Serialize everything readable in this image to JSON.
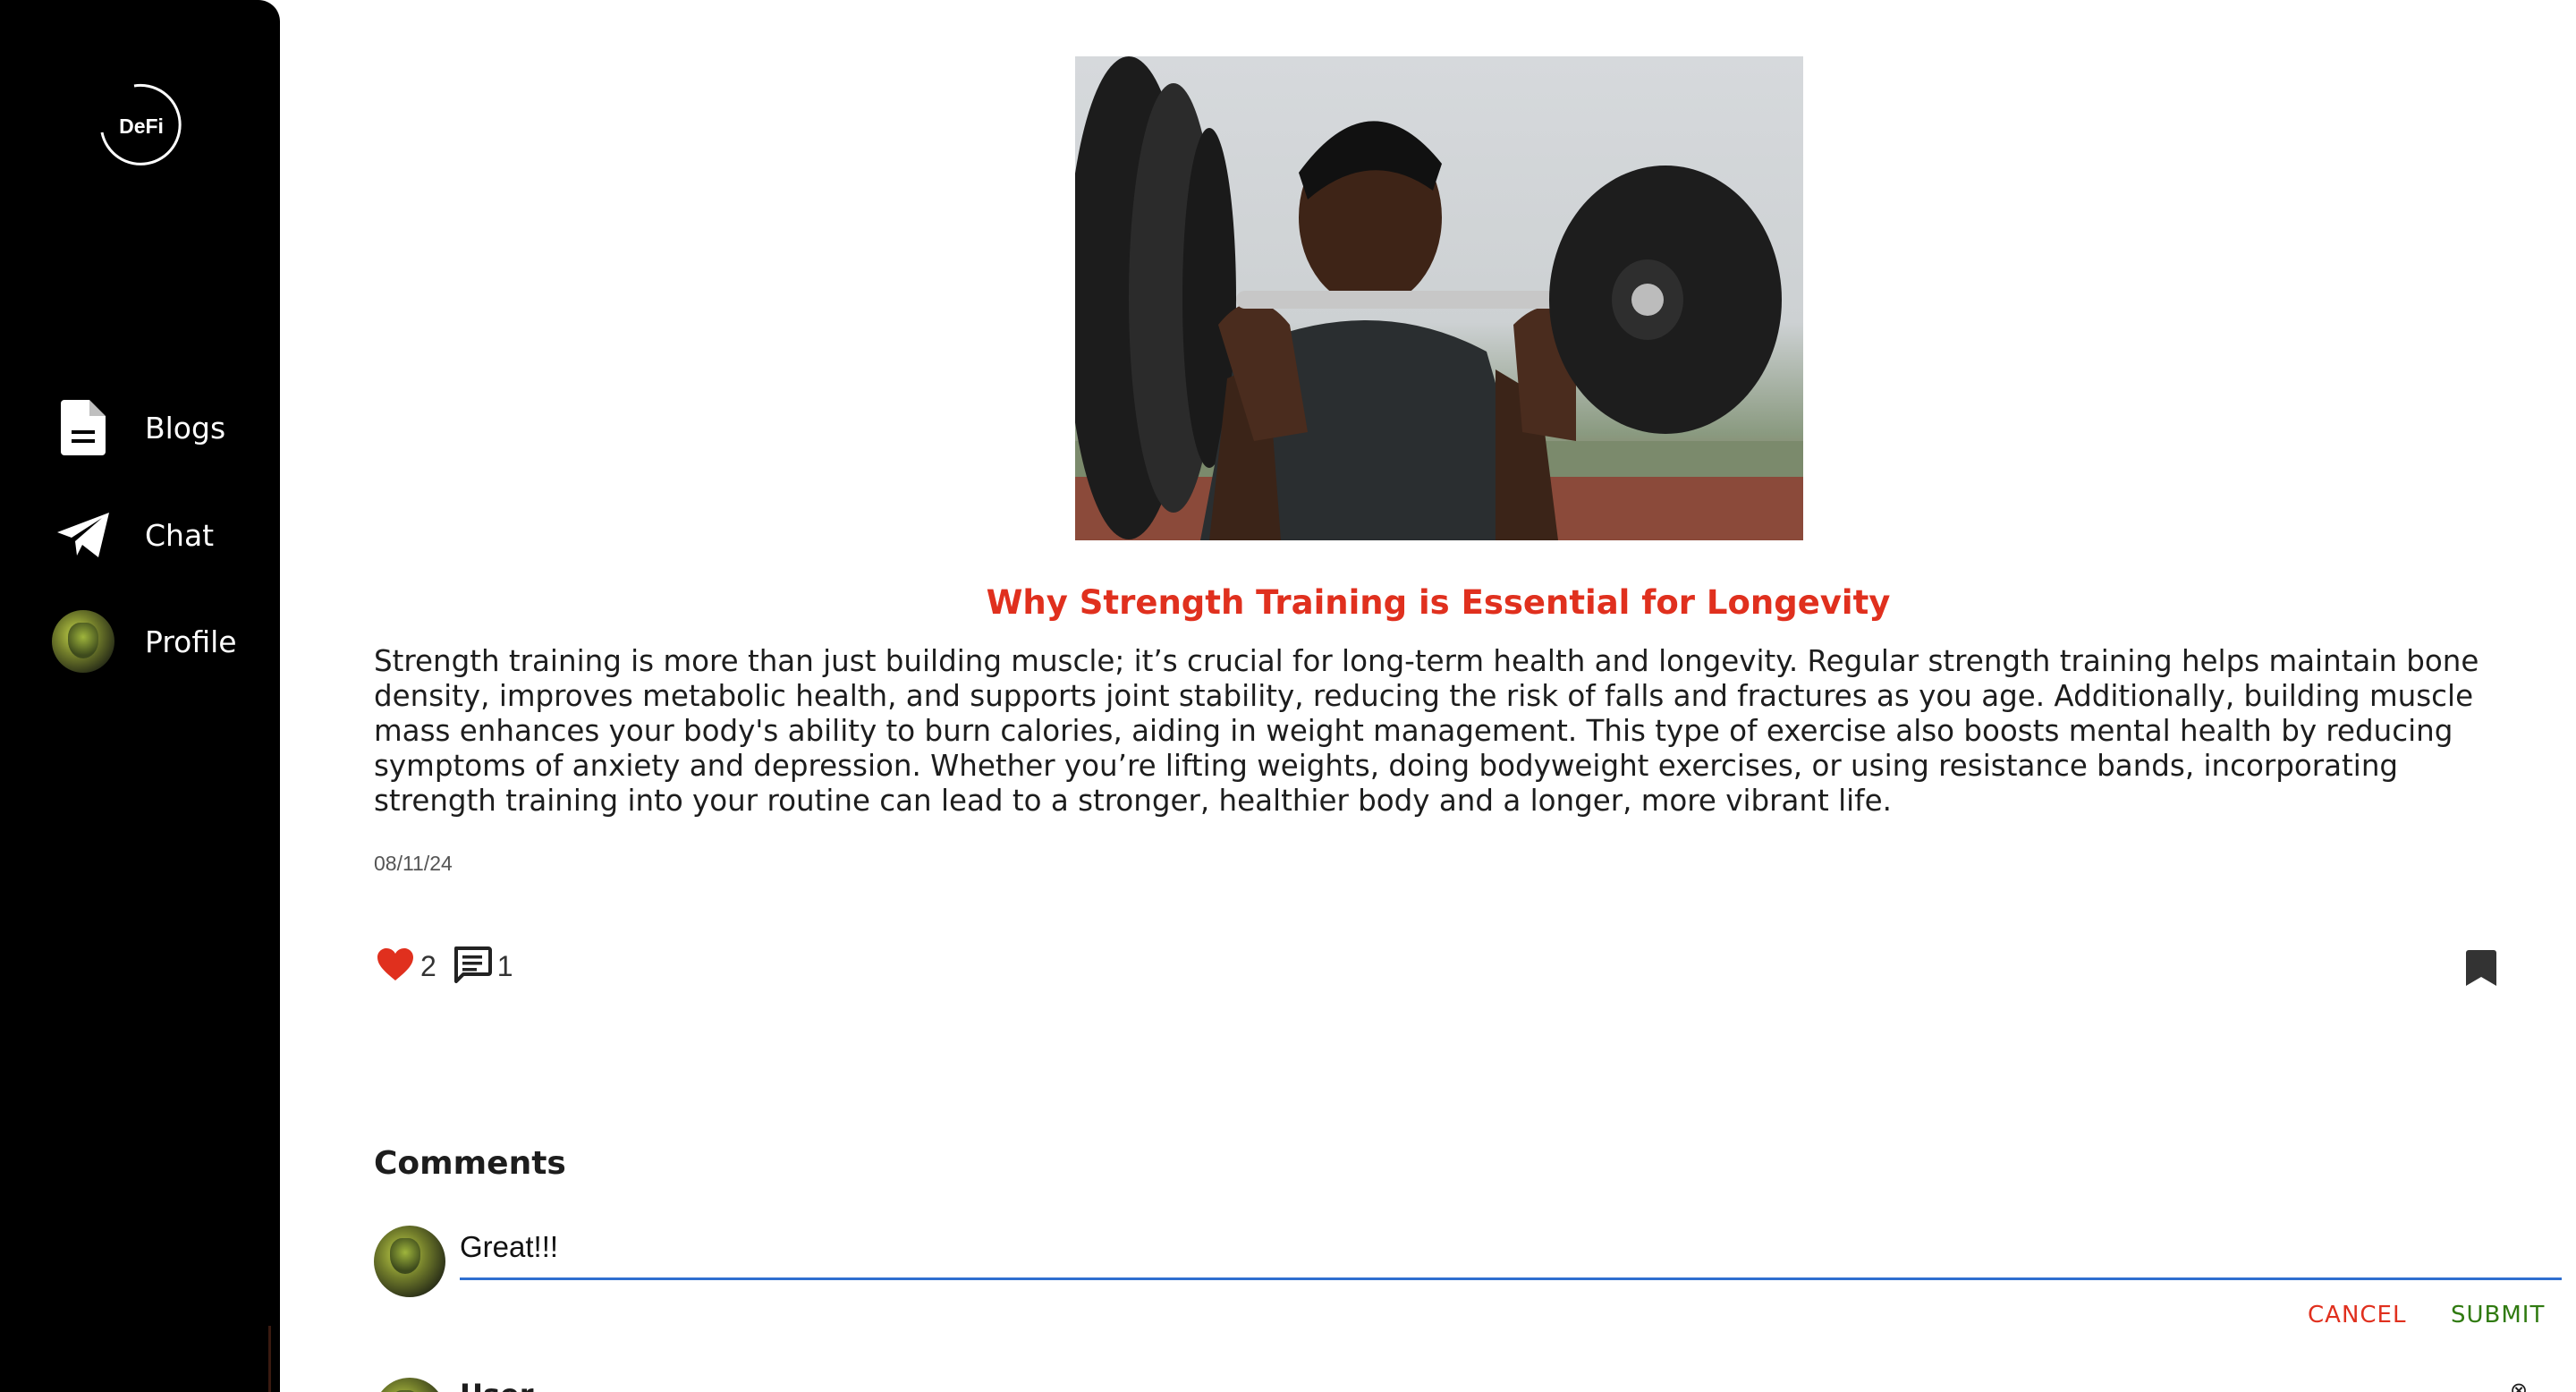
{
  "sidebar": {
    "logo_text": "DeFi",
    "items": [
      {
        "label": "Blogs",
        "icon": "document-icon"
      },
      {
        "label": "Chat",
        "icon": "paper-plane-icon"
      },
      {
        "label": "Profile",
        "icon": "avatar"
      }
    ]
  },
  "post": {
    "title": "Why Strength Training is Essential for Longevity",
    "body": "Strength training is more than just building muscle; it’s crucial for long-term health and longevity. Regular strength training helps maintain bone density, improves metabolic health, and supports joint stability, reducing the risk of falls and fractures as you age. Additionally, building muscle mass enhances your body's ability to burn calories, aiding in weight management. This type of exercise also boosts mental health by reducing symptoms of anxiety and depression. Whether you’re lifting weights, doing bodyweight exercises, or using resistance bands, incorporating strength training into your routine can lead to a stronger, healthier body and a longer, more vibrant life.",
    "date": "08/11/24",
    "likes": "2",
    "comments_count": "1"
  },
  "comments": {
    "heading": "Comments",
    "input_value": "Great!!!",
    "cancel_label": "CANCEL",
    "submit_label": "SUBMIT",
    "next_author": "User"
  },
  "colors": {
    "accent_red": "#e0301e",
    "submit_green": "#2f7a10",
    "input_underline": "#2f6fd0"
  }
}
